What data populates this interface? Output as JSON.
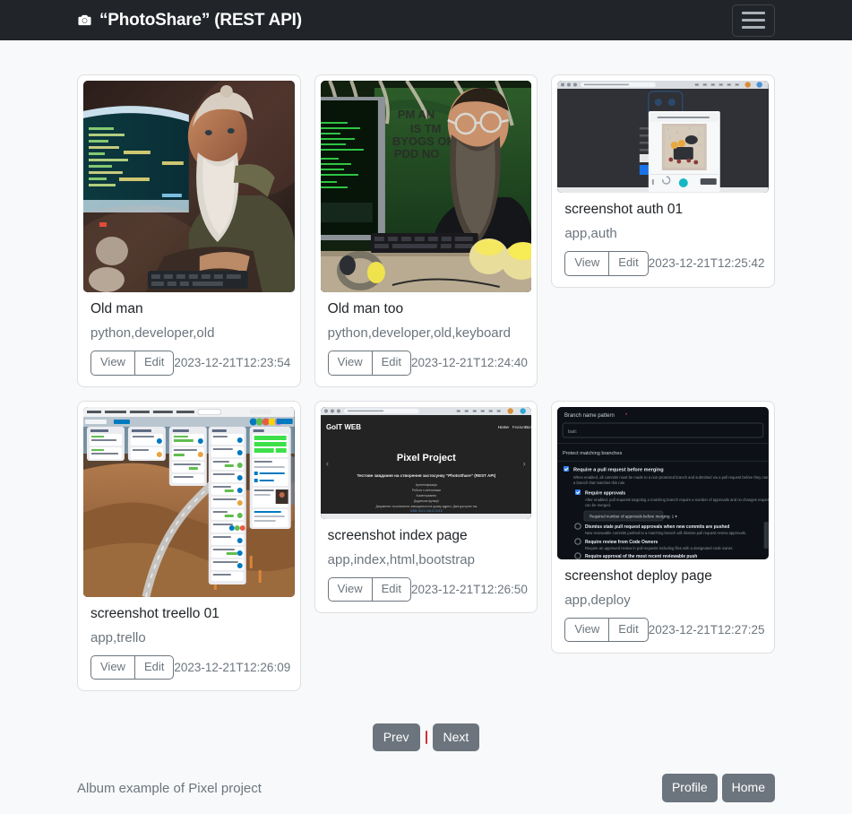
{
  "navbar": {
    "brand_title": "“PhotoShare” (REST API)",
    "brand_icon": "camera-icon",
    "toggle_icon": "hamburger-menu-icon",
    "bg_color": "#212529"
  },
  "album": {
    "cards": [
      {
        "title": "Old man",
        "tags": "python,developer,old",
        "view_label": "View",
        "edit_label": "Edit",
        "timestamp": "2023-12-21T12:23:54",
        "image_alt": "old-man-with-white-beard-at-computer"
      },
      {
        "title": "Old man too",
        "tags": "python,developer,old,keyboard",
        "view_label": "View",
        "edit_label": "Edit",
        "timestamp": "2023-12-21T12:24:40",
        "image_alt": "bearded-man-with-glasses-at-computer"
      },
      {
        "title": "screenshot auth 01",
        "tags": "app,auth",
        "view_label": "View",
        "edit_label": "Edit",
        "timestamp": "2023-12-21T12:25:42",
        "image_alt": "browser-screenshot-auth-modal-dialog"
      },
      {
        "title": "screenshot treello 01",
        "tags": "app,trello",
        "view_label": "View",
        "edit_label": "Edit",
        "timestamp": "2023-12-21T12:26:09",
        "image_alt": "trello-board-screenshot-with-mountain-road-background"
      },
      {
        "title": "screenshot index page",
        "tags": "app,index,html,bootstrap",
        "view_label": "View",
        "edit_label": "Edit",
        "timestamp": "2023-12-21T12:26:50",
        "image_alt": "dark-landing-page-pixel-project"
      },
      {
        "title": "screenshot deploy page",
        "tags": "app,deploy",
        "view_label": "View",
        "edit_label": "Edit",
        "timestamp": "2023-12-21T12:27:25",
        "image_alt": "github-branch-protection-settings-dark"
      }
    ]
  },
  "pagination": {
    "prev_label": "Prev",
    "next_label": "Next",
    "separator_color": "#d32f2f"
  },
  "footer": {
    "text": "Album example of Pixel project",
    "profile_label": "Profile",
    "home_label": "Home"
  },
  "colors": {
    "page_bg": "#f8f9fa",
    "card_bg": "#ffffff",
    "secondary": "#6c757d",
    "dark": "#212529"
  }
}
